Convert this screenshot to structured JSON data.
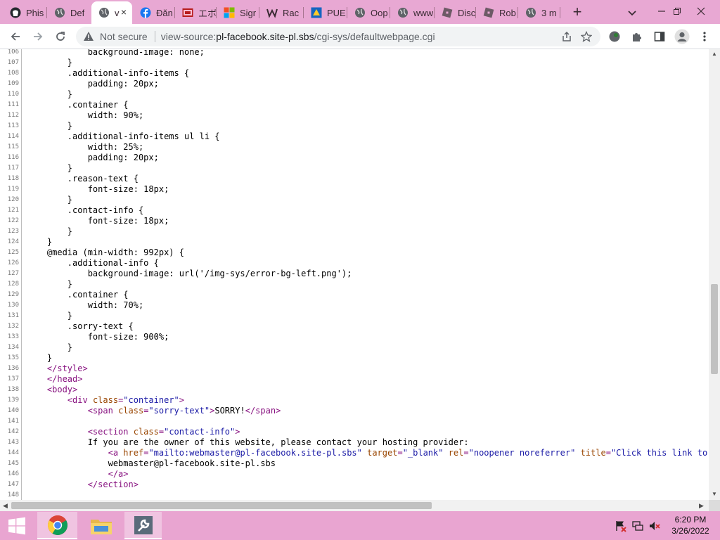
{
  "browser": {
    "tabs": [
      {
        "title": "Phis",
        "icon": "github-icon",
        "active": false
      },
      {
        "title": "Def",
        "icon": "globe-icon",
        "active": false
      },
      {
        "title": "v",
        "icon": "globe-icon",
        "active": true
      },
      {
        "title": "Đăn",
        "icon": "facebook-icon",
        "active": false
      },
      {
        "title": "エボ",
        "icon": "site-icon",
        "active": false
      },
      {
        "title": "Sigr",
        "icon": "microsoft-icon",
        "active": false
      },
      {
        "title": "Rac",
        "icon": "w-icon",
        "active": false
      },
      {
        "title": "PUE",
        "icon": "game-icon",
        "active": false
      },
      {
        "title": "Oop",
        "icon": "globe-icon",
        "active": false
      },
      {
        "title": "www",
        "icon": "globe-icon",
        "active": false
      },
      {
        "title": "Disc",
        "icon": "roblox-icon",
        "active": false
      },
      {
        "title": "Rob",
        "icon": "roblox-icon",
        "active": false
      },
      {
        "title": "3 m",
        "icon": "globe-icon",
        "active": false
      }
    ],
    "new_tab_label": "+",
    "close_tab_label": "×",
    "omnibox": {
      "security_label": "Not secure",
      "url_prefix": "view-source:",
      "url_host": "pl-facebook.site-pl.sbs",
      "url_path": "/cgi-sys/defaultwebpage.cgi"
    },
    "accent_color": "#e8a8d3"
  },
  "source": {
    "lines": [
      {
        "n": "106",
        "code": "            background-image: none;"
      },
      {
        "n": "107",
        "code": "        }"
      },
      {
        "n": "108",
        "code": "        .additional-info-items {"
      },
      {
        "n": "109",
        "code": "            padding: 20px;"
      },
      {
        "n": "110",
        "code": "        }"
      },
      {
        "n": "111",
        "code": "        .container {"
      },
      {
        "n": "112",
        "code": "            width: 90%;"
      },
      {
        "n": "113",
        "code": "        }"
      },
      {
        "n": "114",
        "code": "        .additional-info-items ul li {"
      },
      {
        "n": "115",
        "code": "            width: 25%;"
      },
      {
        "n": "116",
        "code": "            padding: 20px;"
      },
      {
        "n": "117",
        "code": "        }"
      },
      {
        "n": "118",
        "code": "        .reason-text {"
      },
      {
        "n": "119",
        "code": "            font-size: 18px;"
      },
      {
        "n": "120",
        "code": "        }"
      },
      {
        "n": "121",
        "code": "        .contact-info {"
      },
      {
        "n": "122",
        "code": "            font-size: 18px;"
      },
      {
        "n": "123",
        "code": "        }"
      },
      {
        "n": "124",
        "code": "    }"
      },
      {
        "n": "125",
        "code": "    @media (min-width: 992px) {"
      },
      {
        "n": "126",
        "code": "        .additional-info {"
      },
      {
        "n": "127",
        "code": "            background-image: url('/img-sys/error-bg-left.png');"
      },
      {
        "n": "128",
        "code": "        }"
      },
      {
        "n": "129",
        "code": "        .container {"
      },
      {
        "n": "130",
        "code": "            width: 70%;"
      },
      {
        "n": "131",
        "code": "        }"
      },
      {
        "n": "132",
        "code": "        .sorry-text {"
      },
      {
        "n": "133",
        "code": "            font-size: 900%;"
      },
      {
        "n": "134",
        "code": "        }"
      },
      {
        "n": "135",
        "code": "    }"
      },
      {
        "n": "136",
        "segs": [
          {
            "t": "</style>",
            "c": "tagc"
          }
        ],
        "indent": "</style>"
      },
      {
        "n": "137",
        "segs": [
          {
            "t": "</head>",
            "c": "tagc"
          }
        ],
        "indent": ""
      },
      {
        "n": "138",
        "segs": [
          {
            "t": "<body>",
            "c": "tagc"
          }
        ],
        "indent": ""
      },
      {
        "n": "139",
        "segs": [
          {
            "t": "    ",
            "c": ""
          },
          {
            "t": "<div ",
            "c": "tagc"
          },
          {
            "t": "class",
            "c": "attr"
          },
          {
            "t": "=",
            "c": "tagc"
          },
          {
            "t": "\"container\"",
            "c": "val"
          },
          {
            "t": ">",
            "c": "tagc"
          }
        ]
      },
      {
        "n": "140",
        "segs": [
          {
            "t": "        ",
            "c": ""
          },
          {
            "t": "<span ",
            "c": "tagc"
          },
          {
            "t": "class",
            "c": "attr"
          },
          {
            "t": "=",
            "c": "tagc"
          },
          {
            "t": "\"sorry-text\"",
            "c": "val"
          },
          {
            "t": ">",
            "c": "tagc"
          },
          {
            "t": "SORRY!",
            "c": ""
          },
          {
            "t": "</span>",
            "c": "tagc"
          }
        ]
      },
      {
        "n": "141",
        "code": ""
      },
      {
        "n": "142",
        "segs": [
          {
            "t": "        ",
            "c": ""
          },
          {
            "t": "<section ",
            "c": "tagc"
          },
          {
            "t": "class",
            "c": "attr"
          },
          {
            "t": "=",
            "c": "tagc"
          },
          {
            "t": "\"contact-info\"",
            "c": "val"
          },
          {
            "t": ">",
            "c": "tagc"
          }
        ]
      },
      {
        "n": "143",
        "code": "            If you are the owner of this website, please contact your hosting provider:"
      },
      {
        "n": "144",
        "segs": [
          {
            "t": "            ",
            "c": ""
          },
          {
            "t": "<a ",
            "c": "tagc"
          },
          {
            "t": "href",
            "c": "attr"
          },
          {
            "t": "=",
            "c": "tagc"
          },
          {
            "t": "\"mailto:webmaster@pl-facebook.site-pl.sbs\"",
            "c": "val"
          },
          {
            "t": " target",
            "c": "attr"
          },
          {
            "t": "=",
            "c": "tagc"
          },
          {
            "t": "\"_blank\"",
            "c": "val"
          },
          {
            "t": " rel",
            "c": "attr"
          },
          {
            "t": "=",
            "c": "tagc"
          },
          {
            "t": "\"noopener noreferrer\"",
            "c": "val"
          },
          {
            "t": " title",
            "c": "attr"
          },
          {
            "t": "=",
            "c": "tagc"
          },
          {
            "t": "\"Click this link to c",
            "c": "val"
          }
        ]
      },
      {
        "n": "145",
        "code": "                webmaster@pl-facebook.site-pl.sbs"
      },
      {
        "n": "146",
        "segs": [
          {
            "t": "            ",
            "c": ""
          },
          {
            "t": "</a>",
            "c": "tagc"
          }
        ]
      },
      {
        "n": "147",
        "segs": [
          {
            "t": "        ",
            "c": ""
          },
          {
            "t": "</section>",
            "c": "tagc"
          }
        ]
      },
      {
        "n": "148",
        "code": ""
      }
    ]
  },
  "taskbar": {
    "apps": [
      {
        "name": "start-button",
        "icon": "windows-icon"
      },
      {
        "name": "chrome-app",
        "icon": "chrome-icon"
      },
      {
        "name": "file-explorer-app",
        "icon": "folder-icon"
      },
      {
        "name": "settings-tool-app",
        "icon": "wrench-icon"
      }
    ],
    "clock": {
      "time": "6:20 PM",
      "date": "3/26/2022"
    }
  }
}
